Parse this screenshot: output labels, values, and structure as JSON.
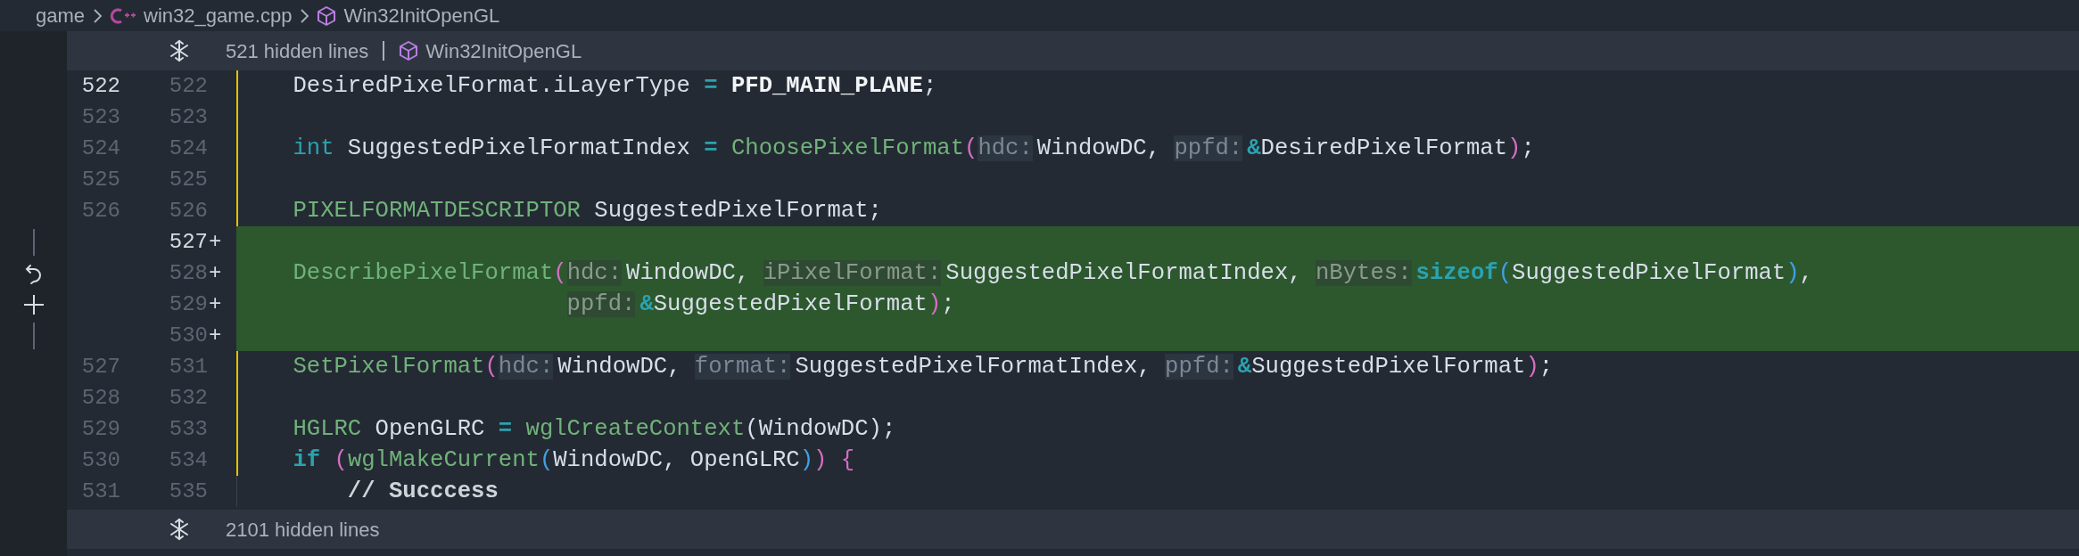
{
  "breadcrumb": [
    {
      "kind": "folder",
      "label": "game"
    },
    {
      "kind": "file",
      "label": "win32_game.cpp"
    },
    {
      "kind": "symbol",
      "label": "Win32InitOpenGL"
    }
  ],
  "hidden_top": {
    "text": "521 hidden lines",
    "symbol": "Win32InitOpenGL"
  },
  "rows": [
    {
      "old": "522",
      "new": "522",
      "old_active": true,
      "new_active": false,
      "added": false,
      "changed": true,
      "tokens": [
        {
          "kind": "id",
          "text": "    DesiredPixelFormat.iLayerType "
        },
        {
          "kind": "op",
          "text": "="
        },
        {
          "kind": "macro",
          "text": " PFD_MAIN_PLANE"
        },
        {
          "kind": "p",
          "text": ";"
        }
      ]
    },
    {
      "old": "523",
      "new": "523",
      "old_active": false,
      "new_active": false,
      "added": false,
      "changed": true
    },
    {
      "old": "524",
      "new": "524",
      "old_active": false,
      "new_active": false,
      "added": false,
      "changed": true,
      "tokens": [
        {
          "kind": "kw",
          "text": "    int"
        },
        {
          "kind": "id",
          "text": " SuggestedPixelFormatIndex "
        },
        {
          "kind": "op",
          "text": "="
        },
        {
          "kind": "func",
          "text": " ChoosePixelFormat"
        },
        {
          "kind": "b1",
          "text": "("
        },
        {
          "kind": "hint",
          "text": "hdc:"
        },
        {
          "kind": "id",
          "text": "WindowDC, "
        },
        {
          "kind": "hint",
          "text": "ppfd:"
        },
        {
          "kind": "op",
          "text": "&"
        },
        {
          "kind": "id",
          "text": "DesiredPixelFormat"
        },
        {
          "kind": "b1",
          "text": ")"
        },
        {
          "kind": "p",
          "text": ";"
        }
      ]
    },
    {
      "old": "525",
      "new": "525",
      "old_active": false,
      "new_active": false,
      "added": false,
      "changed": true
    },
    {
      "old": "526",
      "new": "526",
      "old_active": false,
      "new_active": false,
      "added": false,
      "changed": true,
      "tokens": [
        {
          "kind": "type",
          "text": "    PIXELFORMATDESCRIPTOR"
        },
        {
          "kind": "id",
          "text": " SuggestedPixelFormat;"
        }
      ]
    },
    {
      "new": "527",
      "marker": "+",
      "new_active": true,
      "added": true,
      "changed": true
    },
    {
      "new": "528",
      "marker": "+",
      "new_active": false,
      "added": true,
      "changed": true,
      "tokens": [
        {
          "kind": "func",
          "text": "    DescribePixelFormat"
        },
        {
          "kind": "b1",
          "text": "("
        },
        {
          "kind": "hint",
          "text": "hdc:"
        },
        {
          "kind": "id",
          "text": "WindowDC, "
        },
        {
          "kind": "hint",
          "text": "iPixelFormat:"
        },
        {
          "kind": "id",
          "text": "SuggestedPixelFormatIndex, "
        },
        {
          "kind": "hint",
          "text": "nBytes:"
        },
        {
          "kind": "kwb",
          "text": "sizeof"
        },
        {
          "kind": "b2",
          "text": "("
        },
        {
          "kind": "id",
          "text": "SuggestedPixelFormat"
        },
        {
          "kind": "b2",
          "text": ")"
        },
        {
          "kind": "p",
          "text": ","
        }
      ]
    },
    {
      "new": "529",
      "marker": "+",
      "new_active": false,
      "added": true,
      "changed": true,
      "hanging": true,
      "tokens": [
        {
          "kind": "hint",
          "text": "ppfd:"
        },
        {
          "kind": "op",
          "text": "&"
        },
        {
          "kind": "id",
          "text": "SuggestedPixelFormat"
        },
        {
          "kind": "b1",
          "text": ")"
        },
        {
          "kind": "p",
          "text": ";"
        }
      ]
    },
    {
      "new": "530",
      "marker": "+",
      "new_active": false,
      "added": true,
      "changed": true
    },
    {
      "old": "527",
      "new": "531",
      "old_active": false,
      "new_active": false,
      "added": false,
      "changed": true,
      "tokens": [
        {
          "kind": "func",
          "text": "    SetPixelFormat"
        },
        {
          "kind": "b1",
          "text": "("
        },
        {
          "kind": "hint",
          "text": "hdc:"
        },
        {
          "kind": "id",
          "text": "WindowDC, "
        },
        {
          "kind": "hint",
          "text": "format:"
        },
        {
          "kind": "id",
          "text": "SuggestedPixelFormatIndex, "
        },
        {
          "kind": "hint",
          "text": "ppfd:"
        },
        {
          "kind": "op",
          "text": "&"
        },
        {
          "kind": "id",
          "text": "SuggestedPixelFormat"
        },
        {
          "kind": "b1",
          "text": ")"
        },
        {
          "kind": "p",
          "text": ";"
        }
      ]
    },
    {
      "old": "528",
      "new": "532",
      "old_active": false,
      "new_active": false,
      "added": false,
      "changed": true
    },
    {
      "old": "529",
      "new": "533",
      "old_active": false,
      "new_active": false,
      "added": false,
      "changed": true,
      "tokens": [
        {
          "kind": "type",
          "text": "    HGLRC"
        },
        {
          "kind": "id",
          "text": " OpenGLRC "
        },
        {
          "kind": "op",
          "text": "="
        },
        {
          "kind": "func",
          "text": " wglCreateContext"
        },
        {
          "kind": "id",
          "text": "(WindowDC);"
        }
      ]
    },
    {
      "old": "530",
      "new": "534",
      "old_active": false,
      "new_active": false,
      "added": false,
      "changed": true,
      "tokens": [
        {
          "kind": "kwb",
          "text": "    if"
        },
        {
          "kind": "b1",
          "text": " ("
        },
        {
          "kind": "func",
          "text": "wglMakeCurrent"
        },
        {
          "kind": "b2",
          "text": "("
        },
        {
          "kind": "id",
          "text": "WindowDC, OpenGLRC"
        },
        {
          "kind": "b2",
          "text": ")"
        },
        {
          "kind": "b1",
          "text": ")"
        },
        {
          "kind": "b1",
          "text": " {"
        }
      ]
    },
    {
      "old": "531",
      "new": "535",
      "old_active": false,
      "new_active": false,
      "added": false,
      "changed": false,
      "tokens": [
        {
          "kind": "comment",
          "text": "        // Succcess"
        }
      ]
    }
  ],
  "hidden_bottom": {
    "text": "2101 hidden lines"
  }
}
